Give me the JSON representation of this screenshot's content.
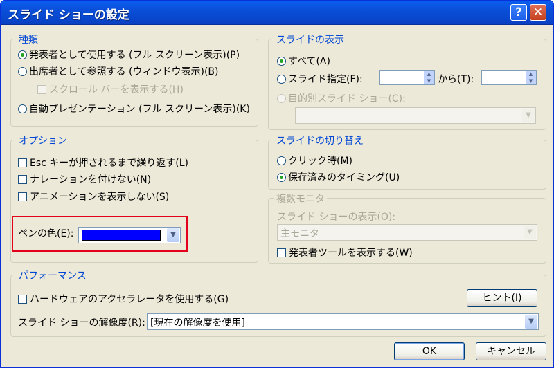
{
  "title": "スライド ショーの設定",
  "titlebar": {
    "help_label": "?",
    "close_label": "✕"
  },
  "type_group": {
    "legend": "種類",
    "presenter": "発表者として使用する (フル スクリーン表示)(P)",
    "browsed_window": "出席者として参照する (ウィンドウ表示)(B)",
    "show_scrollbar": "スクロール バーを表示する(H)",
    "kiosk": "自動プレゼンテーション (フル スクリーン表示)(K)",
    "selected": "presenter"
  },
  "slides_group": {
    "legend": "スライドの表示",
    "all": "すべて(A)",
    "from": "スライド指定(F):",
    "to": "から(T):",
    "custom_show": "目的別スライド ショー(C):",
    "from_value": "",
    "to_value": "",
    "custom_value": "",
    "selected": "all"
  },
  "options_group": {
    "legend": "オプション",
    "loop": "Esc キーが押されるまで繰り返す(L)",
    "no_narration": "ナレーションを付けない(N)",
    "no_animation": "アニメーションを表示しない(S)",
    "pen_color_label": "ペンの色(E):",
    "pen_color": "#0000ff"
  },
  "advance_group": {
    "legend": "スライドの切り替え",
    "manual": "クリック時(M)",
    "timings": "保存済みのタイミング(U)",
    "selected": "timings"
  },
  "monitors_group": {
    "legend": "複数モニタ",
    "display_label": "スライド ショーの表示(O):",
    "display_value": "主モニタ",
    "presenter_tools": "発表者ツールを表示する(W)"
  },
  "performance_group": {
    "legend": "パフォーマンス",
    "hw_accel": "ハードウェアのアクセラレータを使用する(G)",
    "tips_button": "ヒント(I)",
    "resolution_label": "スライド ショーの解像度(R):",
    "resolution_value": "[現在の解像度を使用]"
  },
  "footer": {
    "ok": "OK",
    "cancel": "キャンセル"
  },
  "colors": {
    "highlight_box": "#e3001b",
    "legend_text": "#0046d5",
    "titlebar": "#0a4fd8"
  }
}
